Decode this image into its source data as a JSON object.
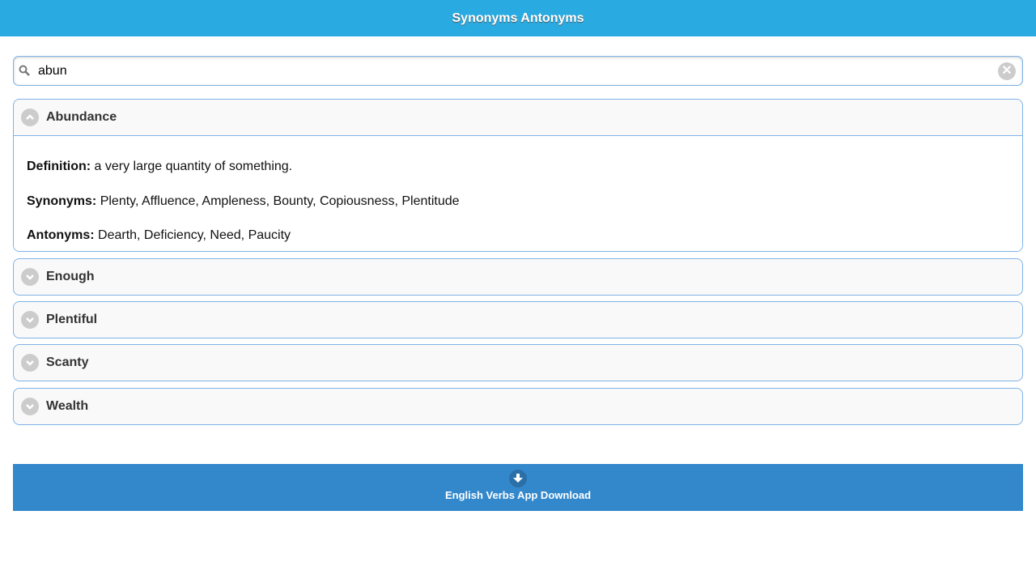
{
  "header": {
    "title": "Synonyms Antonyms"
  },
  "search": {
    "value": "abun"
  },
  "items": [
    {
      "word": "Abundance",
      "expanded": true,
      "definition_label": "Definition:",
      "definition": " a very large quantity of something.",
      "synonyms_label": "Synonyms:",
      "synonyms": " Plenty, Affluence, Ampleness, Bounty, Copiousness, Plentitude",
      "antonyms_label": "Antonyms:",
      "antonyms": " Dearth, Deficiency, Need, Paucity"
    },
    {
      "word": "Enough"
    },
    {
      "word": "Plentiful"
    },
    {
      "word": "Scanty"
    },
    {
      "word": "Wealth"
    }
  ],
  "download": {
    "label": "English Verbs App Download"
  }
}
